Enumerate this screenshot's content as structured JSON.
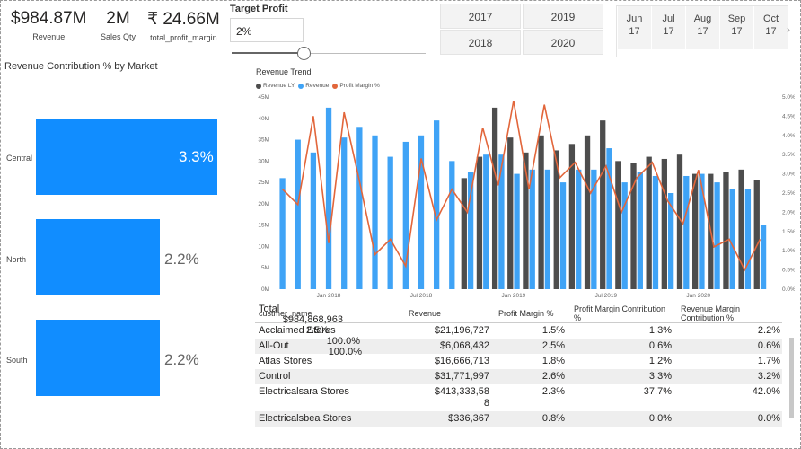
{
  "kpis": [
    {
      "value": "$984.87M",
      "label": "Revenue"
    },
    {
      "value": "2M",
      "label": "Sales Qty"
    },
    {
      "value": "₹ 24.66M",
      "label": "total_profit_margin"
    }
  ],
  "target_profit": {
    "title": "Target Profit",
    "value": "2%",
    "slider_value_pct": 2
  },
  "year_slicer": [
    "2017",
    "2019",
    "2018",
    "2020"
  ],
  "month_slicer": [
    {
      "month": "Jun",
      "year": "17"
    },
    {
      "month": "Jul",
      "year": "17"
    },
    {
      "month": "Aug",
      "year": "17"
    },
    {
      "month": "Sep",
      "year": "17"
    },
    {
      "month": "Oct",
      "year": "17"
    }
  ],
  "month_next_icon": "chevron-right-icon",
  "revenue_contribution": {
    "title": "Revenue Contribution % by Market",
    "markets": [
      {
        "name": "Central",
        "value_pct": 3.3,
        "label": "3.3%"
      },
      {
        "name": "North",
        "value_pct": 2.2,
        "label": "2.2%"
      },
      {
        "name": "South",
        "value_pct": 2.2,
        "label": "2.2%"
      }
    ]
  },
  "revenue_trend": {
    "title": "Revenue Trend",
    "legend": [
      "Revenue LY",
      "Revenue",
      "Profit Margin %"
    ]
  },
  "chart_data": {
    "type": "bar",
    "title": "Revenue Trend",
    "colors": {
      "revenue_ly": "#4d4d4d",
      "revenue": "#3fa3f6",
      "profit_margin": "#e2663b"
    },
    "y_left_ticks": [
      "0M",
      "5M",
      "10M",
      "15M",
      "20M",
      "25M",
      "30M",
      "35M",
      "40M",
      "45M"
    ],
    "y_left_lim": [
      0,
      45
    ],
    "y_right_ticks": [
      "0.0%",
      "0.5%",
      "1.0%",
      "1.5%",
      "2.0%",
      "2.5%",
      "3.0%",
      "3.5%",
      "4.0%",
      "4.5%",
      "5.0%"
    ],
    "y_right_lim": [
      0,
      5
    ],
    "x_tick_labels": [
      {
        "label": "Jan 2018",
        "index": 3
      },
      {
        "label": "Jul 2018",
        "index": 9
      },
      {
        "label": "Jan 2019",
        "index": 15
      },
      {
        "label": "Jul 2019",
        "index": 21
      },
      {
        "label": "Jan 2020",
        "index": 27
      }
    ],
    "series": [
      {
        "name": "Revenue LY",
        "values": [
          null,
          null,
          null,
          null,
          null,
          null,
          null,
          null,
          null,
          null,
          null,
          null,
          26,
          31,
          42.5,
          35.5,
          32,
          36,
          32.5,
          34,
          36,
          39.5,
          30,
          29.5,
          31,
          30.5,
          31.5,
          27,
          27,
          27.5,
          28,
          25.5
        ]
      },
      {
        "name": "Revenue",
        "values": [
          26,
          35,
          32,
          42.5,
          35.5,
          38,
          36,
          31,
          34.5,
          36,
          39.5,
          30,
          27.5,
          31.5,
          31.5,
          27,
          28,
          28,
          25,
          28,
          28,
          33,
          25,
          27.5,
          26.5,
          22.5,
          26.5,
          27,
          25,
          23.5,
          23.5,
          15
        ]
      },
      {
        "name": "Profit Margin %",
        "values": [
          2.6,
          2.2,
          4.5,
          1.2,
          4.6,
          2.8,
          0.9,
          1.3,
          0.6,
          3.4,
          1.8,
          2.6,
          2.0,
          4.2,
          2.7,
          4.9,
          2.6,
          4.8,
          2.9,
          3.3,
          2.5,
          3.2,
          2.0,
          2.9,
          3.3,
          2.3,
          1.7,
          3.1,
          1.1,
          1.3,
          0.5,
          1.3
        ]
      }
    ]
  },
  "table": {
    "columns": [
      "custmer_name",
      "Revenue",
      "Profit Margin %",
      "Profit Margin Contribution %",
      "Revenue Margin Contribution %"
    ],
    "rows": [
      [
        "Acclaimed Stores",
        "$21,196,727",
        "1.5%",
        "1.3%",
        "2.2%"
      ],
      [
        "All-Out",
        "$6,068,432",
        "2.5%",
        "0.6%",
        "0.6%"
      ],
      [
        "Atlas Stores",
        "$16,666,713",
        "1.8%",
        "1.2%",
        "1.7%"
      ],
      [
        "Control",
        "$31,771,997",
        "2.6%",
        "3.3%",
        "3.2%"
      ],
      [
        "Electricalsara Stores",
        "$413,333,58\n8",
        "2.3%",
        "37.7%",
        "42.0%"
      ],
      [
        "Electricalsbea Stores",
        "$336,367",
        "0.8%",
        "0.0%",
        "0.0%"
      ]
    ],
    "total": [
      "Total",
      "$984,868,963",
      "2.5%",
      "100.0%",
      "100.0%"
    ]
  }
}
